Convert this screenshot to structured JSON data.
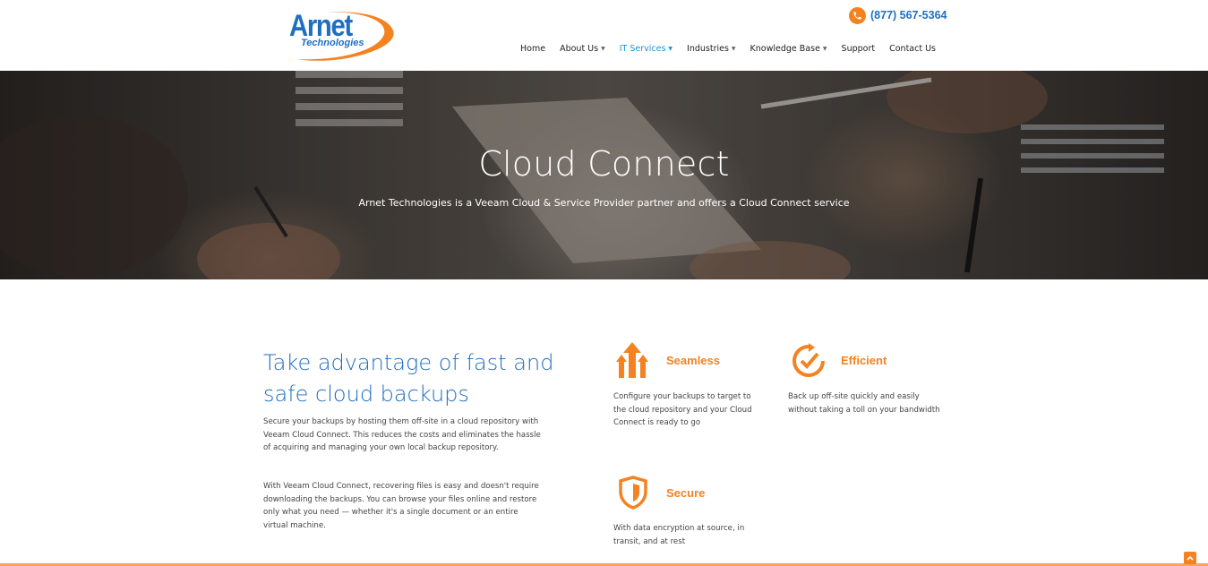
{
  "brand": {
    "logo_main": "Arnet",
    "logo_sub": "Technologies",
    "accent": "#f58220",
    "blue": "#1f6fc1"
  },
  "header": {
    "phone": "(877) 567-5364",
    "phone_icon": "phone-icon",
    "nav": [
      {
        "label": "Home",
        "dropdown": false,
        "active": false
      },
      {
        "label": "About Us",
        "dropdown": true,
        "active": false
      },
      {
        "label": "IT Services",
        "dropdown": true,
        "active": true
      },
      {
        "label": "Industries",
        "dropdown": true,
        "active": false
      },
      {
        "label": "Knowledge Base",
        "dropdown": true,
        "active": false
      },
      {
        "label": "Support",
        "dropdown": false,
        "active": false
      },
      {
        "label": "Contact Us",
        "dropdown": false,
        "active": false
      }
    ]
  },
  "hero": {
    "title": "Cloud Connect",
    "subtitle": "Arnet Technologies is a Veeam Cloud & Service Provider partner and offers a Cloud Connect service"
  },
  "intro": {
    "heading": "Take advantage of fast and safe cloud backups",
    "paragraph1": "Secure your backups by hosting them off-site in a cloud repository with Veeam Cloud Connect. This reduces the costs and eliminates the hassle of acquiring and managing your own local backup repository.",
    "paragraph2": "With Veeam Cloud Connect, recovering files is easy and doesn't require downloading the backups. You can browse your files online and restore only what you need — whether it's a single document or an entire virtual machine."
  },
  "features": [
    {
      "title": "Seamless",
      "icon": "arrows-up-icon",
      "description": "Configure your backups to target to the cloud repository and your Cloud Connect is ready to go"
    },
    {
      "title": "Efficient",
      "icon": "clock-check-icon",
      "description": "Back up off-site quickly and easily without taking a toll on your bandwidth"
    },
    {
      "title": "Secure",
      "icon": "shield-icon",
      "description": "With data encryption at source, in transit, and at rest"
    }
  ],
  "footer": {
    "scroll_top_icon": "chevron-up-icon"
  }
}
